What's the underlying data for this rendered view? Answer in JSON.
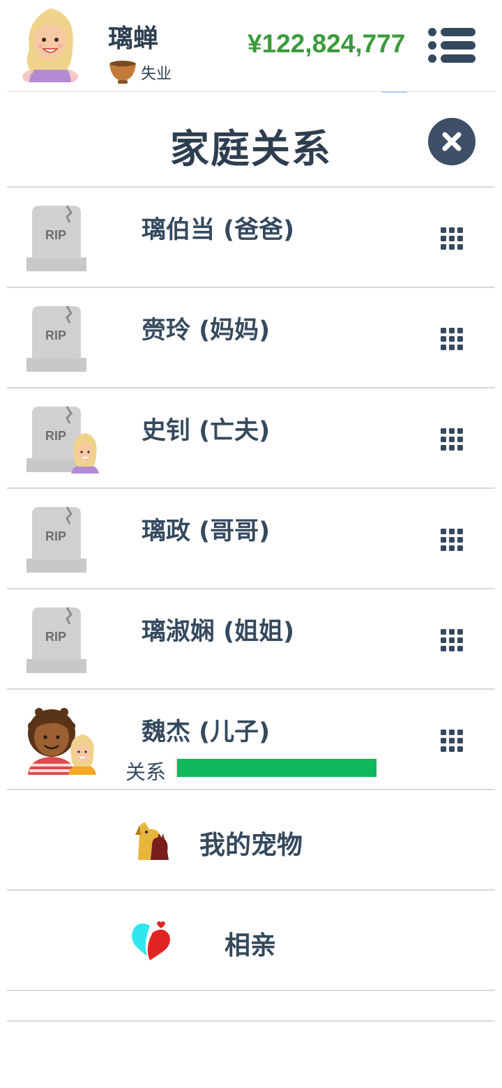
{
  "player": {
    "name": "璃蝉",
    "job": "失业",
    "money": "¥122,824,777"
  },
  "page": {
    "title": "家庭关系"
  },
  "family": [
    {
      "name": "璃伯当 (爸爸)",
      "deceased": true
    },
    {
      "name": "赍玲 (妈妈)",
      "deceased": true
    },
    {
      "name": "史钊 (亡夫)",
      "deceased": true
    },
    {
      "name": "璃政 (哥哥)",
      "deceased": true
    },
    {
      "name": "璃淑娴 (姐姐)",
      "deceased": true
    },
    {
      "name": "魏杰 (儿子)",
      "deceased": false,
      "relation_label": "关系",
      "relation_percent": 100
    }
  ],
  "menu": {
    "pets_label": "我的宠物",
    "dating_label": "相亲"
  },
  "colors": {
    "money": "#3c9a3c",
    "relation_bar": "#0eb85b",
    "text": "#34495e",
    "close_button": "#3e5068"
  },
  "icons": {
    "menu": "list-menu-icon",
    "close": "close-icon",
    "tombstone": "rip-tombstone-icon",
    "options": "grid-dots-icon",
    "job": "bowl-icon",
    "pets": "pets-icon",
    "dating": "dating-heart-icon"
  }
}
